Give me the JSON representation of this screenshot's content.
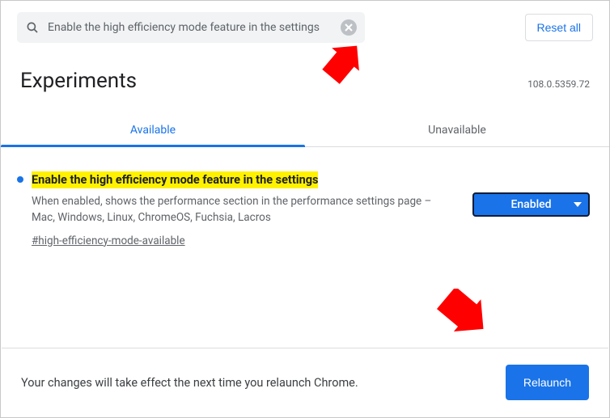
{
  "search": {
    "value": "Enable the high efficiency mode feature in the settings"
  },
  "reset_label": "Reset all",
  "page_title": "Experiments",
  "version": "108.0.5359.72",
  "tabs": {
    "available": "Available",
    "unavailable": "Unavailable"
  },
  "flag": {
    "title": "Enable the high efficiency mode feature in the settings",
    "description": "When enabled, shows the performance section in the performance settings page – Mac, Windows, Linux, ChromeOS, Fuchsia, Lacros",
    "hash": "#high-efficiency-mode-available",
    "selected": "Enabled"
  },
  "bottom": {
    "message": "Your changes will take effect the next time you relaunch Chrome.",
    "relaunch": "Relaunch"
  }
}
